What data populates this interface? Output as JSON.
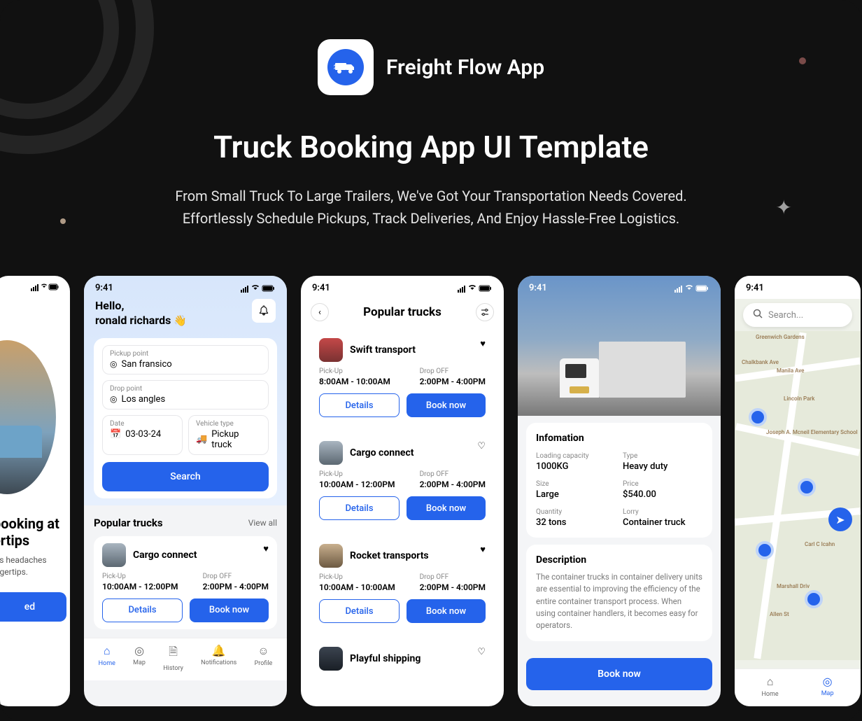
{
  "app": {
    "name": "Freight Flow App",
    "headline": "Truck Booking App UI Template",
    "sub1": "From Small Truck To Large Trailers, We've Got Your Transportation Needs Covered.",
    "sub2": "Effortlessly Schedule Pickups, Track Deliveries, And Enjoy Hassle-Free Logistics."
  },
  "time": "9:41",
  "p0": {
    "title": "booking at ertips",
    "sub": "ics headaches ingertips.",
    "cta": "ed"
  },
  "p1": {
    "hello": "Hello,",
    "name": "ronald richards",
    "fields": {
      "pickup_lbl": "Pickup point",
      "pickup_val": "San fransico",
      "drop_lbl": "Drop point",
      "drop_val": "Los angles",
      "date_lbl": "Date",
      "date_val": "03-03-24",
      "vehicle_lbl": "Vehicle type",
      "vehicle_val": "Pickup truck"
    },
    "search": "Search",
    "popular": "Popular trucks",
    "viewall": "View all",
    "truck": {
      "name": "Cargo connect",
      "pickup_lbl": "Pick-Up",
      "pickup_val": "10:00AM - 12:00PM",
      "drop_lbl": "Drop OFF",
      "drop_val": "2:00PM - 4:00PM",
      "details": "Details",
      "book": "Book now"
    },
    "tabs": {
      "home": "Home",
      "map": "Map",
      "history": "History",
      "notif": "Notifications",
      "profile": "Profile"
    }
  },
  "p2": {
    "title": "Popular trucks",
    "pickup_lbl": "Pick-Up",
    "drop_lbl": "Drop OFF",
    "details": "Details",
    "book": "Book now",
    "trucks": [
      {
        "name": "Swift transport",
        "pickup": "8:00AM - 10:00AM",
        "drop": "2:00PM - 4:00PM"
      },
      {
        "name": "Cargo connect",
        "pickup": "10:00AM - 12:00PM",
        "drop": "2:00PM - 4:00PM"
      },
      {
        "name": "Rocket transports",
        "pickup": "10:00AM - 10:00AM",
        "drop": "2:00PM - 4:00PM"
      },
      {
        "name": "Playful shipping"
      }
    ]
  },
  "p3": {
    "info_title": "Infomation",
    "info": {
      "cap_lbl": "Loading capacity",
      "cap_val": "1000KG",
      "type_lbl": "Type",
      "type_val": "Heavy duty",
      "size_lbl": "Size",
      "size_val": "Large",
      "price_lbl": "Price",
      "price_val": "$540.00",
      "qty_lbl": "Quantity",
      "qty_val": "32 tons",
      "lorry_lbl": "Lorry",
      "lorry_val": "Container truck"
    },
    "desc_title": "Description",
    "desc": "The container trucks in container delivery units are essential to improving the efficiency of the entire container transport process. When using container handlers, it becomes easy for operators.",
    "book": "Book now"
  },
  "p4": {
    "search_ph": "Search...",
    "tabs": {
      "home": "Home",
      "map": "Map"
    },
    "pois": [
      "Greenwich Gardens",
      "Chalkbank Ave",
      "Manila Ave",
      "Lincoln Park",
      "Joseph A. Mcneil Elementary School",
      "Carl C Icahn",
      "Marshall Driv",
      "Allen St"
    ]
  }
}
